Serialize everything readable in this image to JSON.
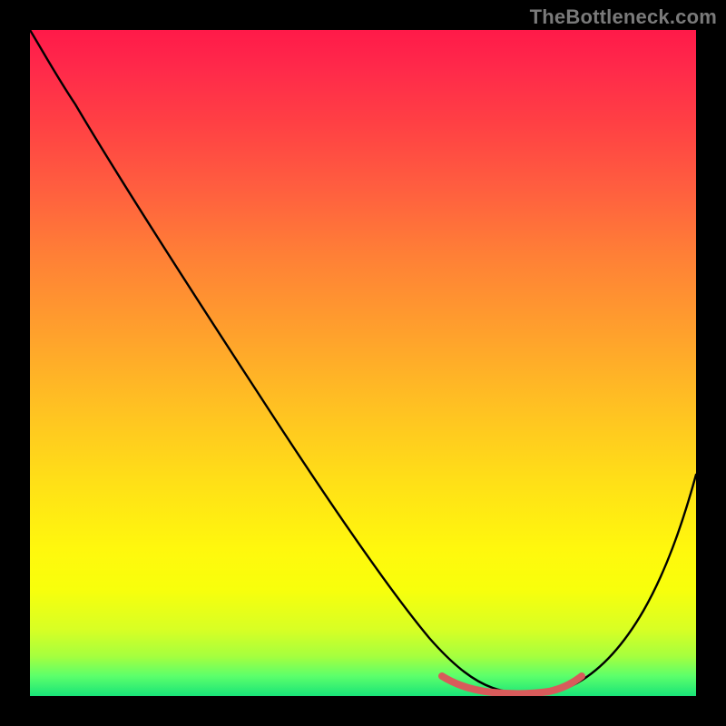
{
  "watermark": {
    "text": "TheBottleneck.com"
  },
  "chart_data": {
    "type": "line",
    "title": "",
    "xlabel": "",
    "ylabel": "",
    "xlim": [
      0,
      100
    ],
    "ylim": [
      0,
      100
    ],
    "grid": false,
    "legend": false,
    "series": [
      {
        "name": "bottleneck-curve",
        "x": [
          0,
          6,
          12,
          20,
          30,
          40,
          50,
          58,
          62,
          66,
          70,
          74,
          78,
          84,
          92,
          100
        ],
        "y": [
          100,
          95,
          89,
          79,
          65,
          51,
          37,
          24,
          15,
          7,
          2,
          0,
          0,
          3,
          15,
          35
        ]
      }
    ],
    "highlight": {
      "name": "optimal-range",
      "x_start": 62,
      "x_end": 82,
      "y": 0
    },
    "background_gradient_stops": [
      {
        "pos": 0.0,
        "color": "#ff1a49"
      },
      {
        "pos": 0.5,
        "color": "#ffb326"
      },
      {
        "pos": 0.8,
        "color": "#fff80d"
      },
      {
        "pos": 1.0,
        "color": "#18e478"
      }
    ]
  }
}
